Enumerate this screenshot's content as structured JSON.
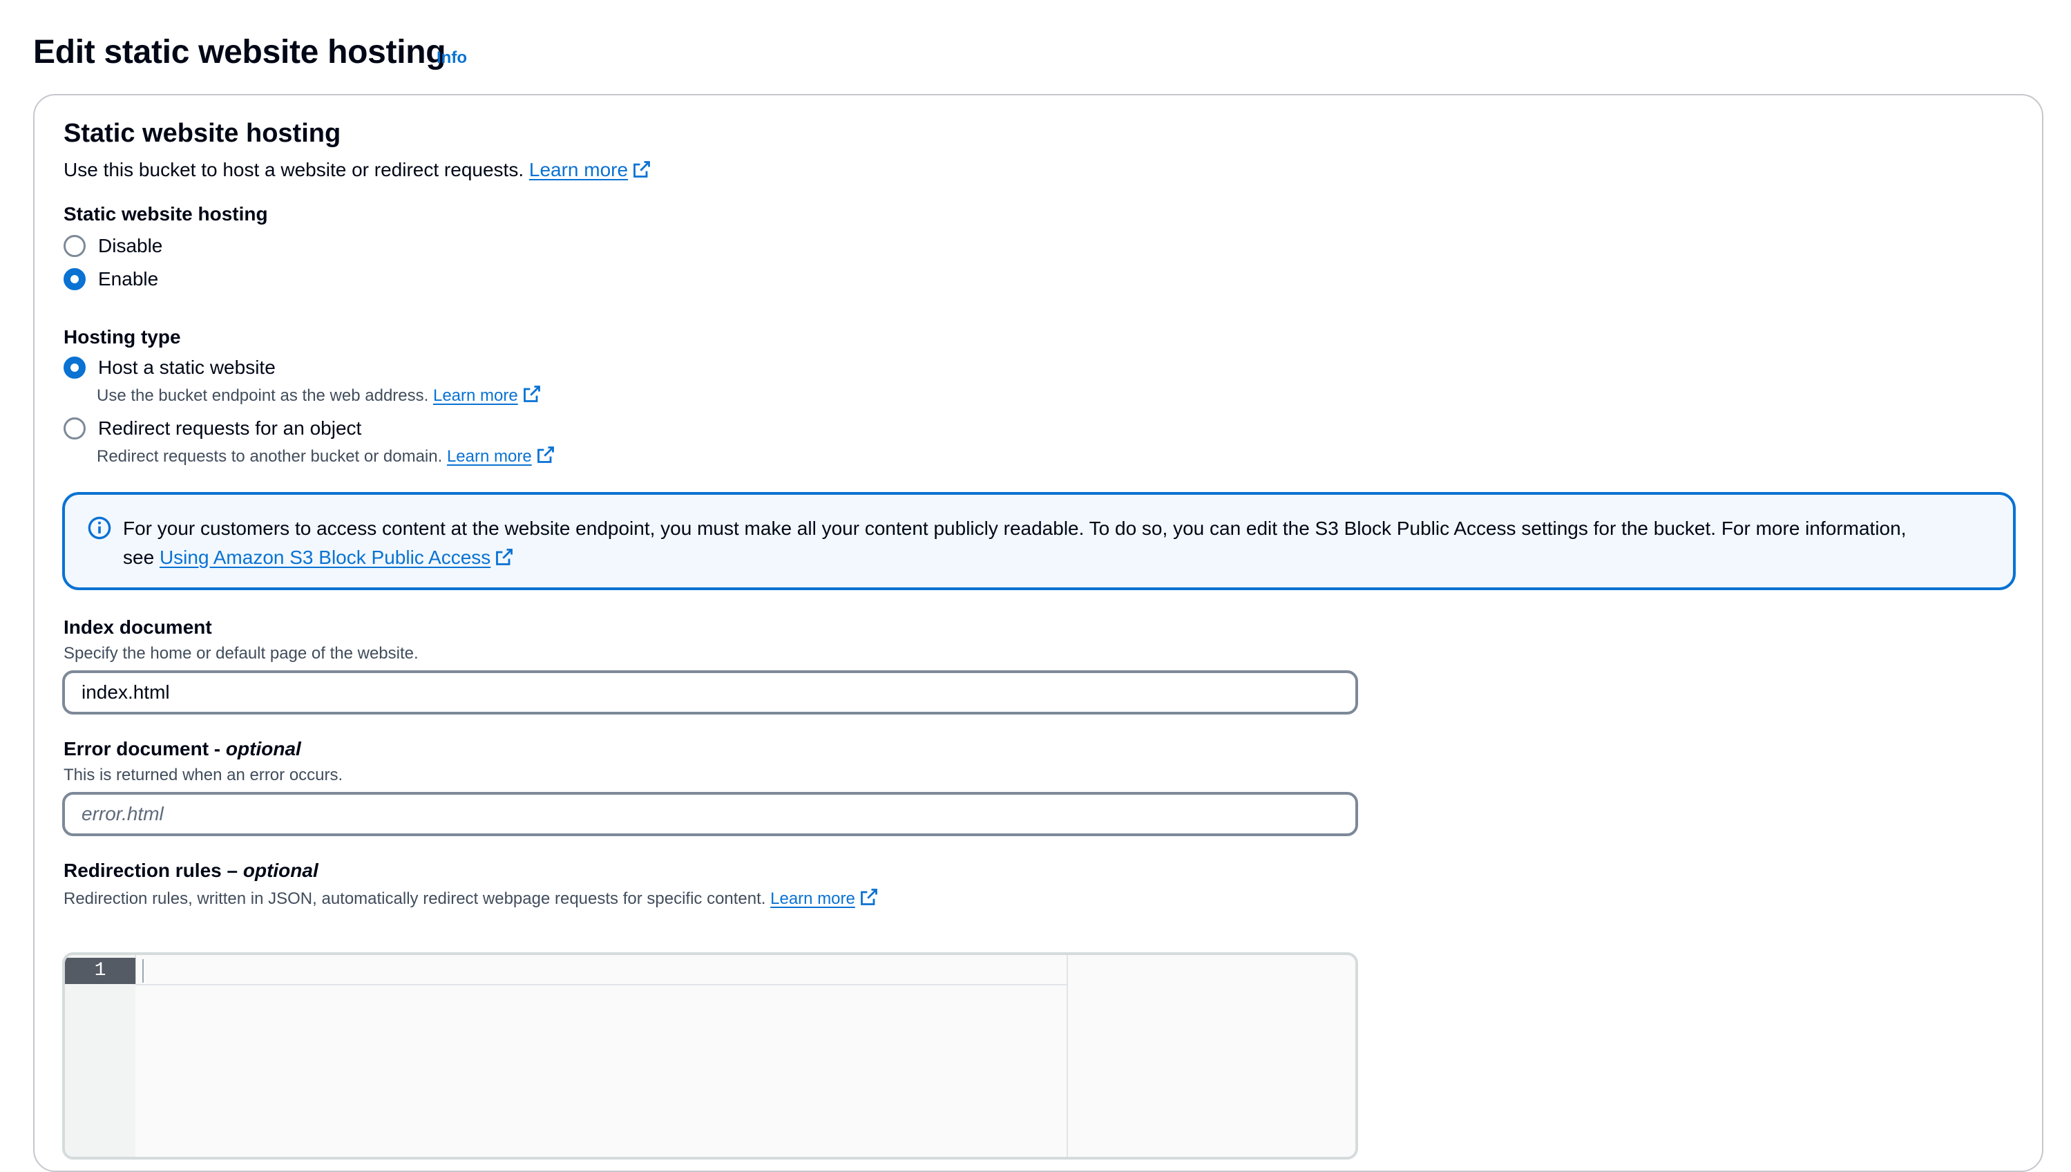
{
  "page": {
    "title": "Edit static website hosting",
    "info_label": "Info"
  },
  "panel": {
    "heading": "Static website hosting",
    "description": "Use this bucket to host a website or redirect requests.",
    "learn_more": "Learn more"
  },
  "hosting_toggle": {
    "label": "Static website hosting",
    "options": [
      {
        "label": "Disable",
        "checked": false
      },
      {
        "label": "Enable",
        "checked": true
      }
    ]
  },
  "hosting_type": {
    "label": "Hosting type",
    "options": [
      {
        "label": "Host a static website",
        "description": "Use the bucket endpoint as the web address.",
        "link": "Learn more",
        "checked": true
      },
      {
        "label": "Redirect requests for an object",
        "description": "Redirect requests to another bucket or domain.",
        "link": "Learn more",
        "checked": false
      }
    ]
  },
  "alert": {
    "text_line1": "For your customers to access content at the website endpoint, you must make all your content publicly readable. To do so, you can edit the S3 Block Public Access settings for the bucket. For more information,",
    "text_see": "see",
    "link": "Using Amazon S3 Block Public Access"
  },
  "index_document": {
    "label": "Index document",
    "description": "Specify the home or default page of the website.",
    "value": "index.html"
  },
  "error_document": {
    "label": "Error document - ",
    "label_optional": "optional",
    "description": "This is returned when an error occurs.",
    "placeholder": "error.html"
  },
  "redirection_rules": {
    "label": "Redirection rules – ",
    "label_optional": "optional",
    "description": "Redirection rules, written in JSON, automatically redirect webpage requests for specific content.",
    "link": "Learn more",
    "line_number": "1"
  },
  "colors": {
    "accent": "#0972d3",
    "alert_bg": "#f2f8fd",
    "text": "#000716"
  }
}
